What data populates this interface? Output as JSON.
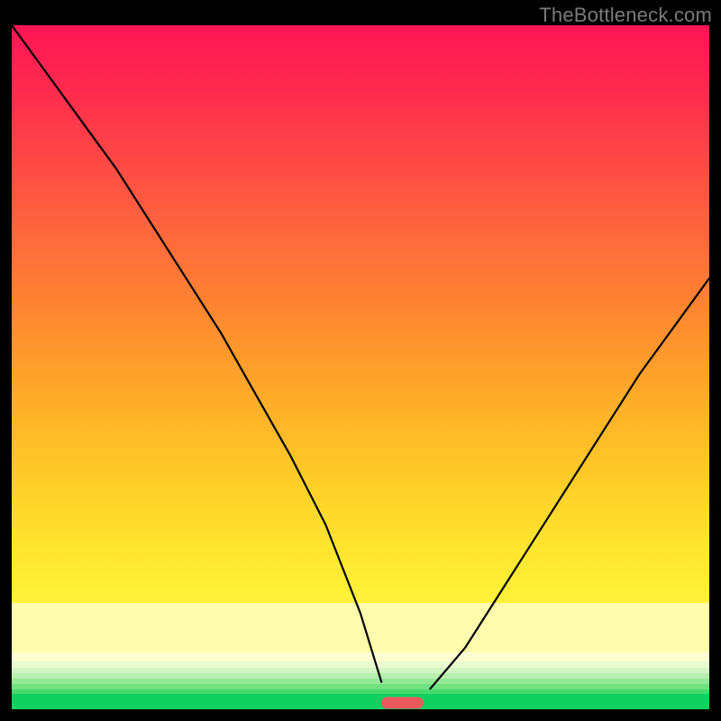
{
  "watermark": "TheBottleneck.com",
  "colors": {
    "frame_bg": "#000000",
    "watermark_text": "#7a7a7a",
    "curve_stroke": "#000000",
    "marker_fill": "#e85a5d",
    "green_band": "#10d160"
  },
  "chart_data": {
    "type": "line",
    "title": "",
    "xlabel": "",
    "ylabel": "",
    "xlim": [
      0,
      100
    ],
    "ylim": [
      0,
      100
    ],
    "x": [
      0,
      5,
      10,
      15,
      20,
      25,
      30,
      35,
      40,
      45,
      50,
      53,
      55,
      57,
      60,
      65,
      70,
      75,
      80,
      85,
      90,
      95,
      100
    ],
    "values": [
      100,
      93,
      86,
      79,
      71,
      63,
      55,
      46,
      37,
      27,
      14,
      4,
      1,
      1,
      3,
      9,
      17,
      25,
      33,
      41,
      49,
      56,
      63
    ],
    "minimum_x": 56,
    "marker": {
      "x_start": 53,
      "x_end": 59,
      "y": 1
    },
    "note": "Values are read off the figure by vertical position relative to the 759px plot height. y=0 is the bottom edge, y=100 is the top edge. No axes, ticks, labels, or legend are rendered in the source image."
  }
}
